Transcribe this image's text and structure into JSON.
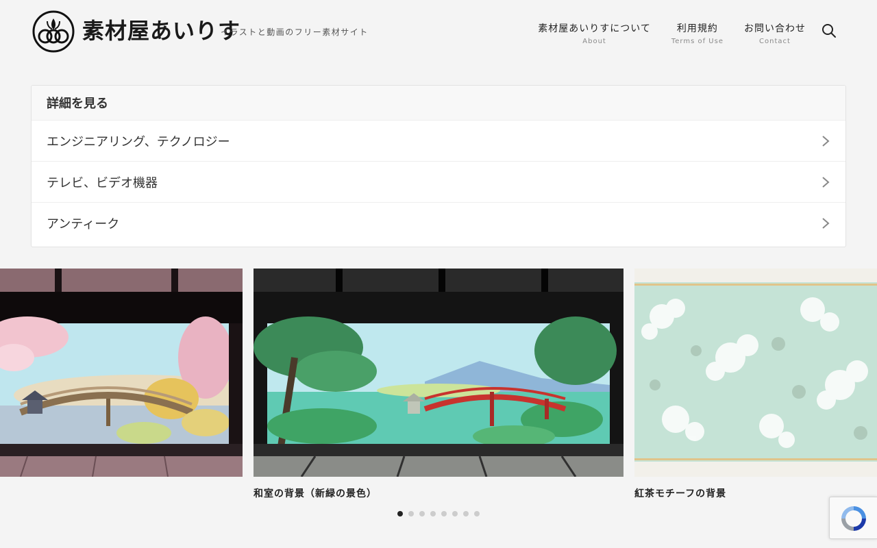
{
  "site": {
    "logo_text": "素材屋あいりす",
    "tagline": "イラストと動画のフリー素材サイト"
  },
  "nav": {
    "items": [
      {
        "label": "素材屋あいりすについて",
        "sub": "About"
      },
      {
        "label": "利用規約",
        "sub": "Terms of Use"
      },
      {
        "label": "お問い合わせ",
        "sub": "Contact"
      }
    ],
    "search_icon": "search-icon"
  },
  "panel": {
    "title": "詳細を見る",
    "items": [
      {
        "label": "エンジニアリング、テクノロジー"
      },
      {
        "label": "テレビ、ビデオ機器"
      },
      {
        "label": "アンティーク"
      }
    ]
  },
  "slider": {
    "slides": [
      {
        "caption": ""
      },
      {
        "caption": "和室の背景（新緑の景色）"
      },
      {
        "caption": "紅茶モチーフの背景"
      }
    ],
    "dot_count": 8,
    "active_dot": 0
  },
  "colors": {
    "background": "#f4f4f4",
    "accent": "#222222",
    "bridge_red": "#c8332e"
  }
}
